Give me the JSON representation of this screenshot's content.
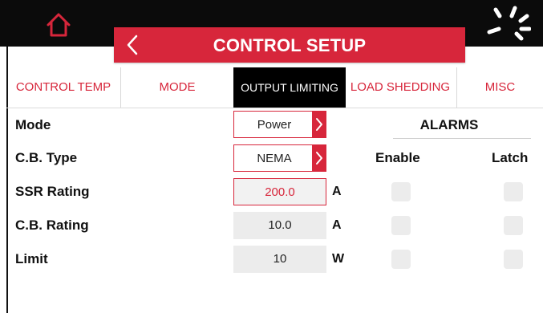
{
  "header": {
    "title": "CONTROL SETUP",
    "home_icon": "home-icon",
    "back_icon": "chevron-left-icon",
    "status_icon": "loading-spinner-icon"
  },
  "tabs": [
    {
      "label": "CONTROL TEMP",
      "active": false
    },
    {
      "label": "MODE",
      "active": false
    },
    {
      "label": "OUTPUT LIMITING",
      "active": true
    },
    {
      "label": "LOAD SHEDDING",
      "active": false
    },
    {
      "label": "MISC",
      "active": false
    }
  ],
  "form": {
    "mode": {
      "label": "Mode",
      "value": "Power"
    },
    "cb_type": {
      "label": "C.B. Type",
      "value": "NEMA"
    },
    "ssr_rating": {
      "label": "SSR Rating",
      "value": "200.0",
      "unit": "A"
    },
    "cb_rating": {
      "label": "C.B. Rating",
      "value": "10.0",
      "unit": "A"
    },
    "limit": {
      "label": "Limit",
      "value": "10",
      "unit": "W"
    }
  },
  "alarms": {
    "title": "ALARMS",
    "enable_label": "Enable",
    "latch_label": "Latch",
    "rows": [
      {
        "row": "SSR Rating",
        "enable": false,
        "latch": false
      },
      {
        "row": "C.B. Rating",
        "enable": false,
        "latch": false
      },
      {
        "row": "Limit",
        "enable": false,
        "latch": false
      }
    ]
  },
  "colors": {
    "accent": "#d7263b",
    "header_bg": "#0b0b0b",
    "field_bg": "#ececec"
  }
}
